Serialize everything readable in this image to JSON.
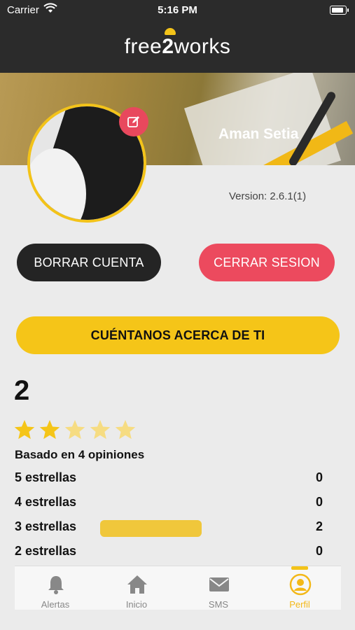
{
  "status_bar": {
    "carrier": "Carrier",
    "time": "5:16 PM"
  },
  "header": {
    "logo_left": "free",
    "logo_two": "2",
    "logo_right": "works"
  },
  "profile": {
    "name": "Aman Setia",
    "version": "Version: 2.6.1(1)"
  },
  "buttons": {
    "delete_account": "BORRAR CUENTA",
    "logout": "CERRAR SESION",
    "about_you": "CUÉNTANOS ACERCA DE TI"
  },
  "rating": {
    "value": "2",
    "stars_filled": 2,
    "stars_total": 5,
    "based_on": "Basado en 4 opiniones",
    "breakdown": [
      {
        "label": "5 estrellas",
        "count": "0",
        "fraction": 0
      },
      {
        "label": "4 estrellas",
        "count": "0",
        "fraction": 0
      },
      {
        "label": "3 estrellas",
        "count": "2",
        "fraction": 0.5
      },
      {
        "label": "2 estrellas",
        "count": "0",
        "fraction": 0
      }
    ]
  },
  "tabbar": {
    "items": [
      {
        "label": "Alertas",
        "icon": "bell-icon"
      },
      {
        "label": "Inicio",
        "icon": "home-icon"
      },
      {
        "label": "SMS",
        "icon": "mail-icon"
      },
      {
        "label": "Perfil",
        "icon": "user-icon"
      }
    ],
    "active_index": 3
  },
  "colors": {
    "accent_yellow": "#f5c518",
    "logout_red": "#ec4a5e",
    "dark": "#242424"
  }
}
